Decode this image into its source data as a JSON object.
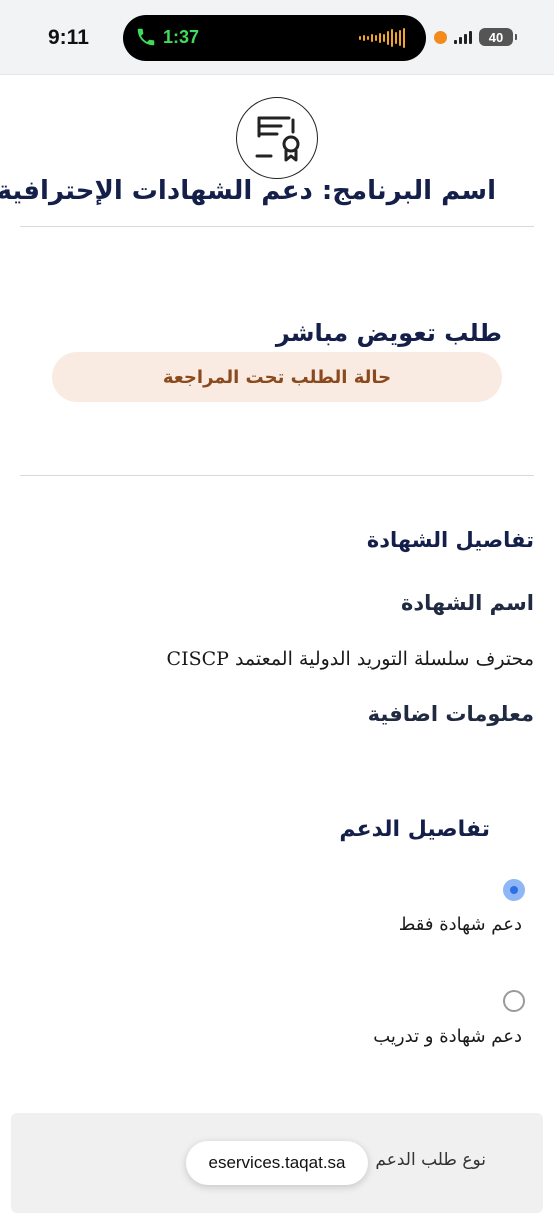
{
  "status_bar": {
    "time": "9:11",
    "call_duration": "1:37",
    "battery": "40",
    "icons": [
      "phone-icon",
      "waveform-icon",
      "recording-dot-icon",
      "signal-icon",
      "battery-icon"
    ]
  },
  "header": {
    "logo_icon": "certificate-icon",
    "program_title": "اسم البرنامج: دعم الشهادات الإحترافية"
  },
  "request": {
    "title": "طلب تعويض مباشر",
    "status": "حالة الطلب تحت المراجعة"
  },
  "certificate": {
    "section_title": "تفاصيل الشهادة",
    "name_label": "اسم الشهادة",
    "name_value": "محترف سلسلة التوريد الدولية المعتمد  CISCP",
    "extra_info_label": "معلومات اضافية"
  },
  "support": {
    "section_title": "تفاصيل الدعم",
    "options": [
      {
        "label": "دعم شهادة فقط",
        "selected": true
      },
      {
        "label": "دعم شهادة و تدريب",
        "selected": false
      }
    ],
    "support_type_label": "نوع طلب الدعم"
  },
  "browser": {
    "url": "eservices.taqat.sa"
  },
  "colors": {
    "title_navy": "#15204a",
    "status_pill_bg": "#f9ebe1",
    "status_text": "#8b4a1d",
    "radio_selected": "#2f6fe6"
  }
}
